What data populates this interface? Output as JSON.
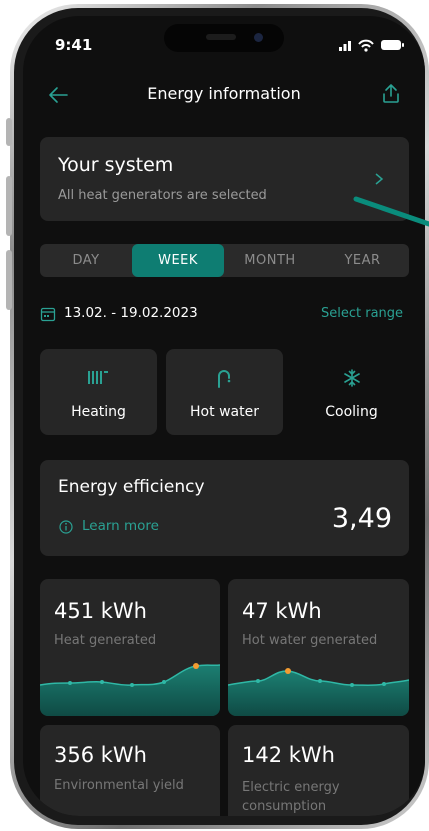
{
  "status_bar": {
    "time": "9:41"
  },
  "header": {
    "title": "Energy information"
  },
  "system_card": {
    "title": "Your system",
    "subtitle": "All heat generators are selected"
  },
  "tabs": [
    {
      "label": "DAY",
      "active": false
    },
    {
      "label": "WEEK",
      "active": true
    },
    {
      "label": "MONTH",
      "active": false
    },
    {
      "label": "YEAR",
      "active": false
    }
  ],
  "date_range": {
    "text": "13.02. - 19.02.2023",
    "select_label": "Select range"
  },
  "categories": [
    {
      "label": "Heating",
      "icon": "heating-icon"
    },
    {
      "label": "Hot water",
      "icon": "hot-water-icon"
    },
    {
      "label": "Cooling",
      "icon": "snowflake-icon"
    }
  ],
  "efficiency": {
    "title": "Energy efficiency",
    "learn_more": "Learn more",
    "value": "3,49"
  },
  "stats": [
    {
      "value": "451 kWh",
      "label": "Heat generated"
    },
    {
      "value": "47 kWh",
      "label": "Hot water generated"
    },
    {
      "value": "356 kWh",
      "label": "Environmental yield"
    },
    {
      "value": "142 kWh",
      "label": "Electric energy consumption"
    }
  ],
  "colors": {
    "accent": "#2aa193",
    "active_tab": "#0e7d72",
    "highlight_dot": "#f39c32",
    "card": "#262626",
    "background": "#0f0f0f",
    "annotation_arrow": "#0a8c7c"
  }
}
